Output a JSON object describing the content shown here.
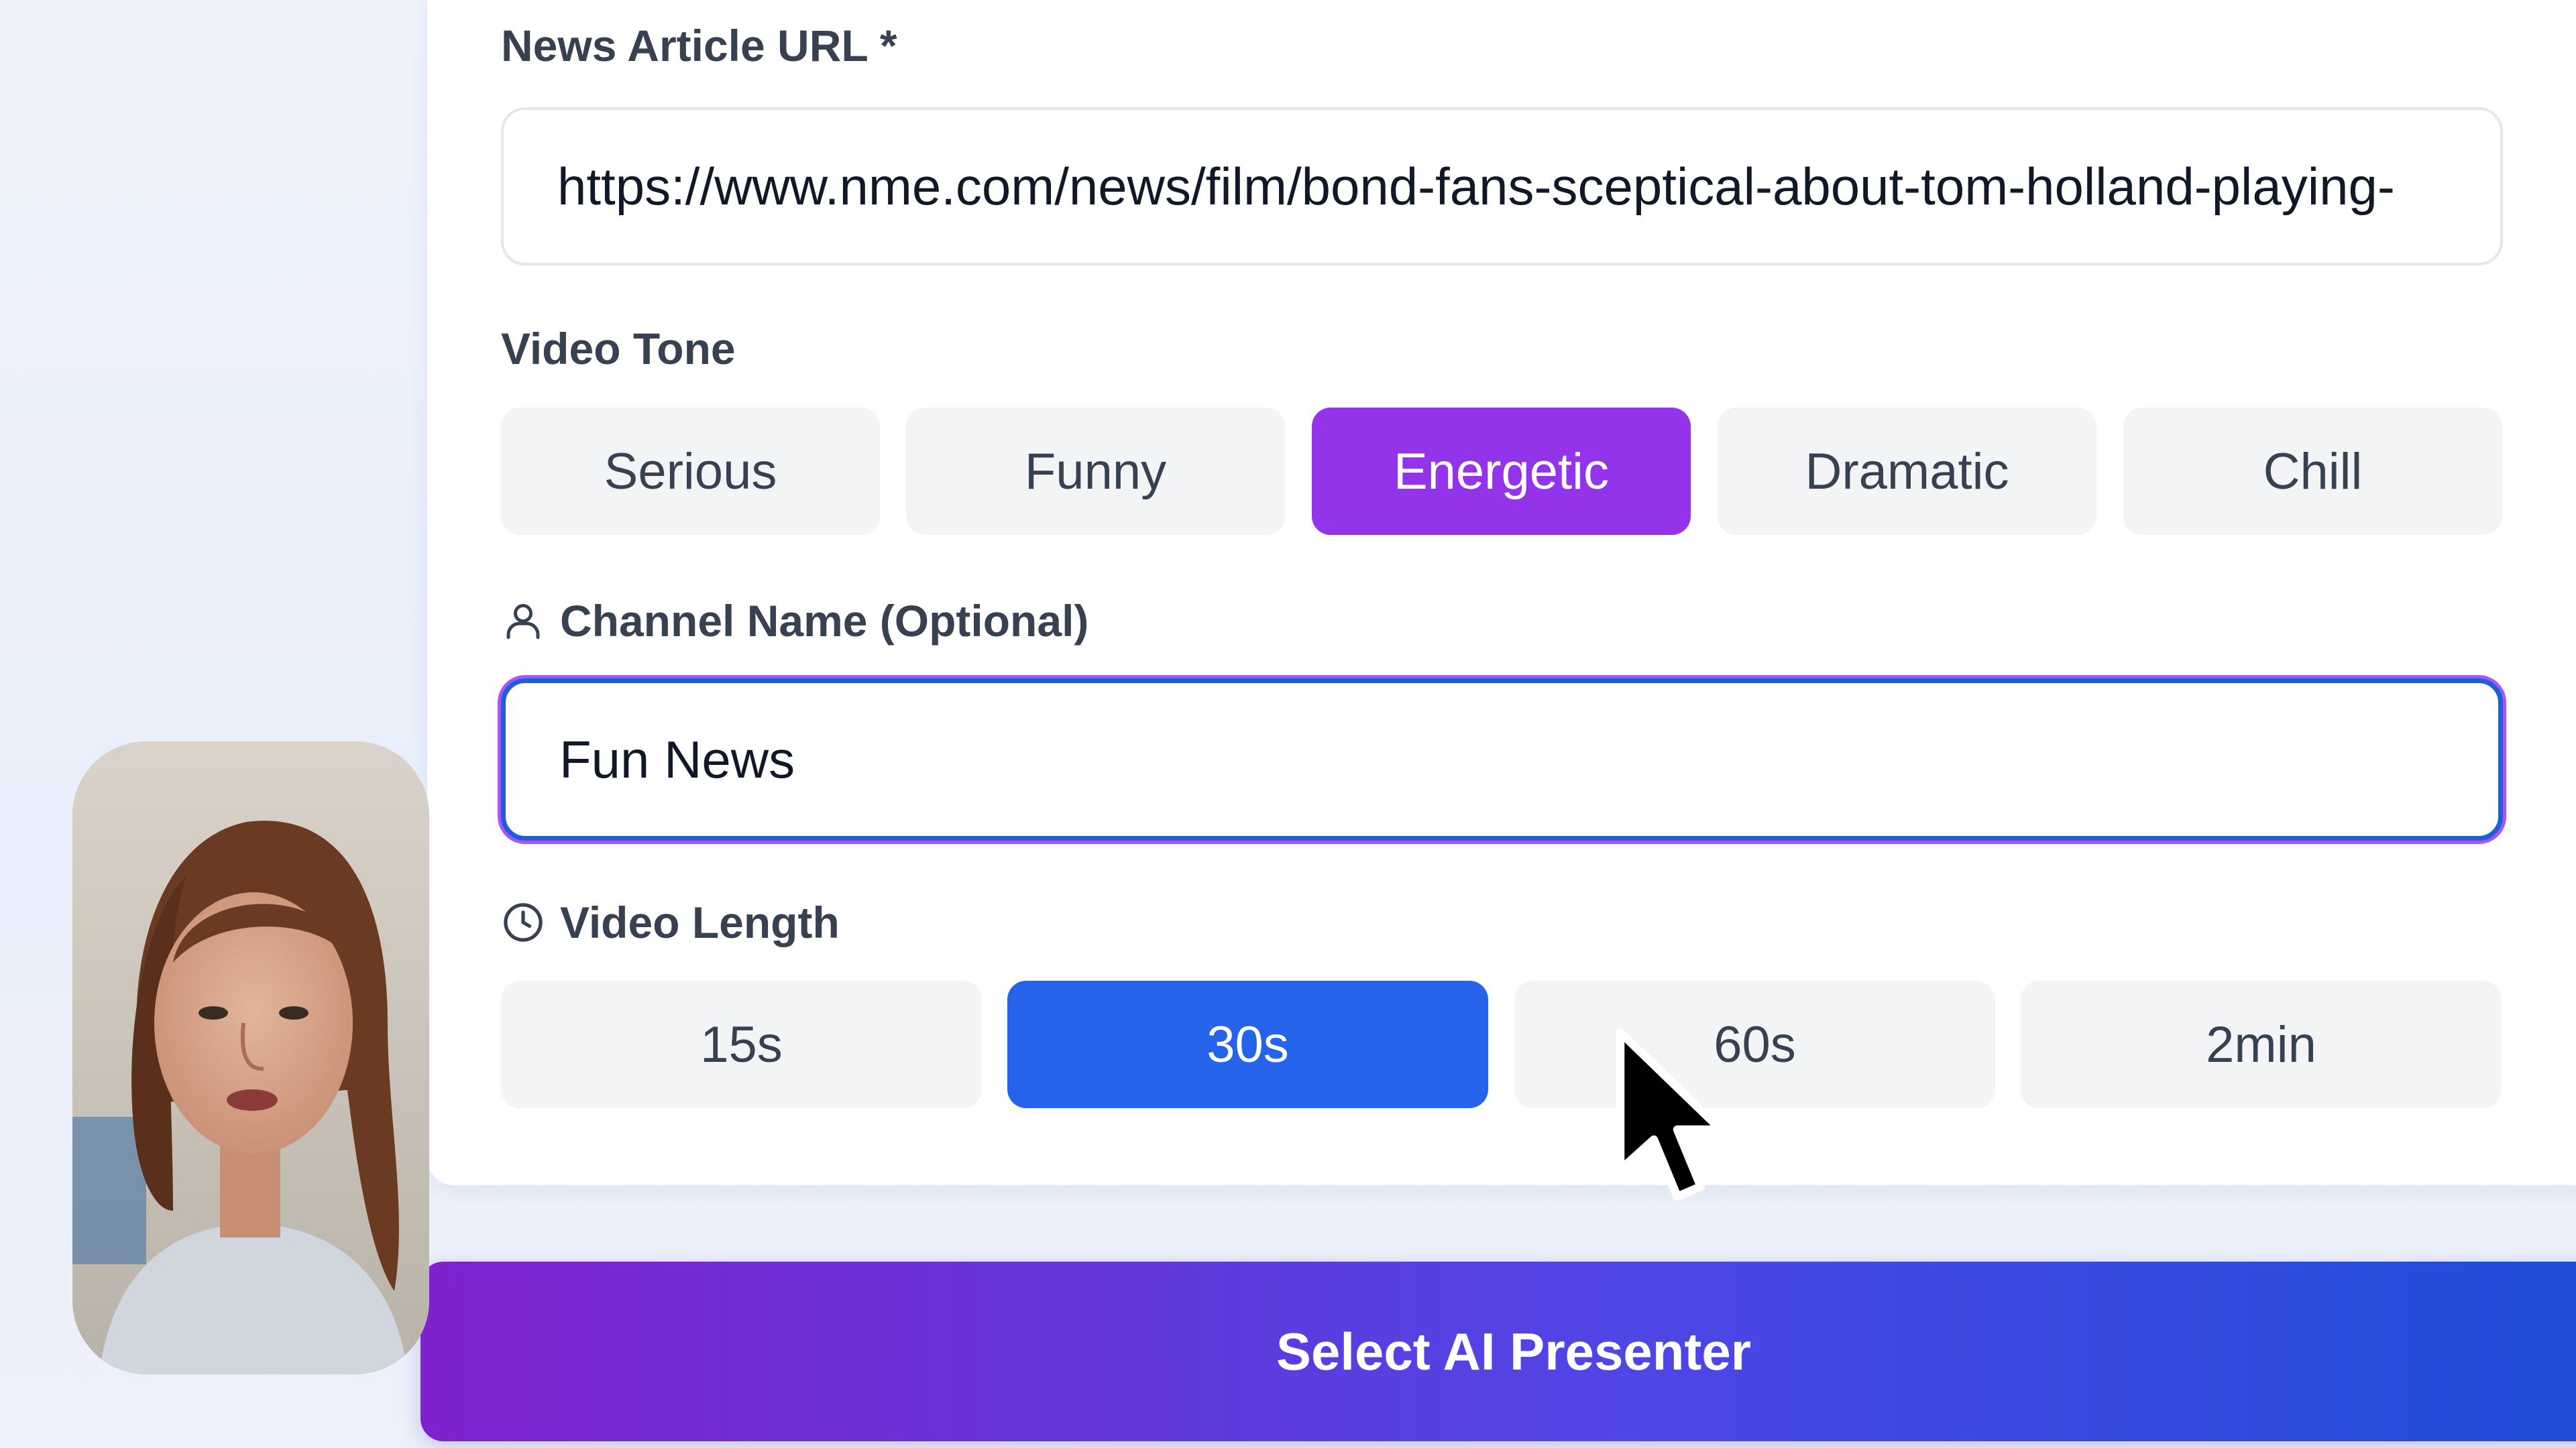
{
  "form": {
    "url": {
      "label": "News Article URL *",
      "value": "https://www.nme.com/news/film/bond-fans-sceptical-about-tom-holland-playing-"
    },
    "tone": {
      "label": "Video Tone",
      "options": [
        "Serious",
        "Funny",
        "Energetic",
        "Dramatic",
        "Chill"
      ],
      "selected": "Energetic"
    },
    "channel": {
      "label": "Channel Name (Optional)",
      "value": "Fun News",
      "icon": "user-icon"
    },
    "length": {
      "label": "Video Length",
      "options": [
        "15s",
        "30s",
        "60s",
        "2min"
      ],
      "selected": "30s",
      "icon": "clock-icon"
    }
  },
  "primary_button": {
    "label": "Select AI Presenter"
  },
  "colors": {
    "tone_selected": "#9333ea",
    "length_selected": "#2563eb",
    "unselected_bg": "#f3f4f6",
    "focus_ring": "#1d5fd6",
    "button_gradient_start": "#7e22ce",
    "button_gradient_end": "#1d4ed8"
  }
}
